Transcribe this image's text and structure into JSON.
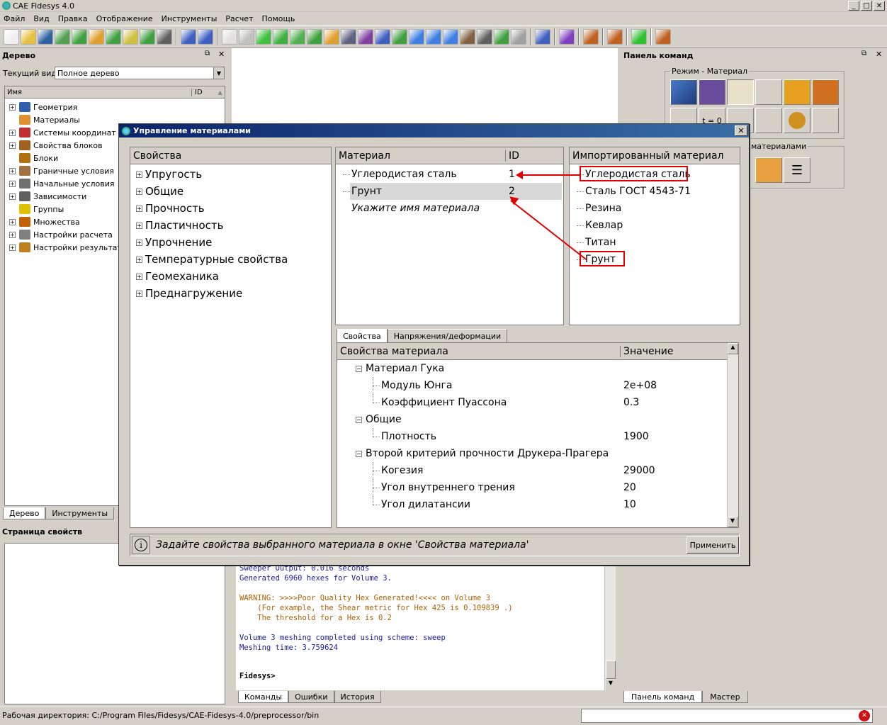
{
  "window": {
    "title": "CAE Fidesys 4.0"
  },
  "menu": [
    "Файл",
    "Вид",
    "Правка",
    "Отображение",
    "Инструменты",
    "Расчет",
    "Помощь"
  ],
  "left": {
    "tree_title": "Дерево",
    "current_view_label": "Текущий вид",
    "current_view_value": "Полное дерево",
    "col_name": "Имя",
    "col_id": "ID",
    "items": [
      {
        "label": "Геометрия",
        "icon": "geometry-icon",
        "color": "#2e5fa8",
        "expand": true
      },
      {
        "label": "Материалы",
        "icon": "materials-icon",
        "color": "#e09030",
        "expand": false
      },
      {
        "label": "Системы координат",
        "icon": "coordinate-icon",
        "color": "#c03030",
        "expand": true
      },
      {
        "label": "Свойства блоков",
        "icon": "block-props-icon",
        "color": "#a06020",
        "expand": true
      },
      {
        "label": "Блоки",
        "icon": "blocks-icon",
        "color": "#b07010",
        "expand": false
      },
      {
        "label": "Граничные условия",
        "icon": "boundary-icon",
        "color": "#a07040",
        "expand": true
      },
      {
        "label": "Начальные условия",
        "icon": "initial-icon",
        "color": "#707070",
        "expand": true
      },
      {
        "label": "Зависимости",
        "icon": "dependency-icon",
        "color": "#606060",
        "expand": true
      },
      {
        "label": "Группы",
        "icon": "groups-icon",
        "color": "#e0c000",
        "expand": false
      },
      {
        "label": "Множества",
        "icon": "sets-icon",
        "color": "#c06000",
        "expand": true
      },
      {
        "label": "Настройки расчета",
        "icon": "calc-settings-icon",
        "color": "#808080",
        "expand": true
      },
      {
        "label": "Настройки результатов",
        "icon": "result-settings-icon",
        "color": "#c08020",
        "expand": true
      }
    ],
    "tabs": [
      "Дерево",
      "Инструменты"
    ],
    "props_title": "Страница свойств"
  },
  "console": {
    "lines": [
      {
        "text": "Sweeper Output: 0.016 seconds",
        "cls": "blue"
      },
      {
        "text": "Generated 6960 hexes for Volume 3.",
        "cls": "blue"
      },
      {
        "text": "",
        "cls": "blue"
      },
      {
        "text": "WARNING: >>>>Poor Quality Hex Generated!<<<< on Volume 3",
        "cls": "orange"
      },
      {
        "text": "    (For example, the Shear metric for Hex 425 is 0.109839 .)",
        "cls": "orange"
      },
      {
        "text": "    The threshold for a Hex is 0.2",
        "cls": "orange"
      },
      {
        "text": "",
        "cls": "blue"
      },
      {
        "text": "Volume 3 meshing completed using scheme: sweep",
        "cls": "blue"
      },
      {
        "text": "Meshing time: 3.759624",
        "cls": "blue"
      }
    ],
    "prompt": "Fidesys>",
    "tabs": [
      "Команды",
      "Ошибки",
      "История"
    ]
  },
  "right": {
    "title": "Панель команд",
    "mode_label": "Режим - Материал",
    "t0_label": "t = 0",
    "group2_label": "материалами",
    "tabs": [
      "Панель команд",
      "Мастер"
    ]
  },
  "statusbar": {
    "text": "Рабочая директория: C:/Program Files/Fidesys/CAE-Fidesys-4.0/preprocessor/bin"
  },
  "dialog": {
    "title": "Управление материалами",
    "props_header": "Свойства",
    "props": [
      "Упругость",
      "Общие",
      "Прочность",
      "Пластичность",
      "Упрочнение",
      "Температурные свойства",
      "Геомеханика",
      "Преднагружение"
    ],
    "mat_header": "Материал",
    "id_header": "ID",
    "materials": [
      {
        "name": "Углеродистая сталь",
        "id": "1"
      },
      {
        "name": "Грунт",
        "id": "2"
      }
    ],
    "mat_placeholder": "Укажите имя материала",
    "imported_header": "Импортированный материал",
    "imported": [
      "Углеродистая сталь",
      "Сталь ГОСТ 4543-71",
      "Резина",
      "Кевлар",
      "Титан",
      "Грунт"
    ],
    "tabs": [
      "Свойства",
      "Напряжения/деформации"
    ],
    "mp_header_name": "Свойства материала",
    "mp_header_value": "Значение",
    "mp_groups": [
      {
        "label": "Материал Гука",
        "rows": [
          {
            "name": "Модуль Юнга",
            "value": "2e+08"
          },
          {
            "name": "Коэффициент Пуассона",
            "value": "0.3"
          }
        ]
      },
      {
        "label": "Общие",
        "rows": [
          {
            "name": "Плотность",
            "value": "1900"
          }
        ]
      },
      {
        "label": "Второй критерий прочности Друкера-Прагера",
        "rows": [
          {
            "name": "Когезия",
            "value": "29000"
          },
          {
            "name": "Угол внутреннего трения",
            "value": "20"
          },
          {
            "name": "Угол дилатансии",
            "value": "10"
          }
        ]
      }
    ],
    "hint": "Задайте свойства выбранного материала в окне 'Свойства материала'",
    "apply": "Применить",
    "accent_red": "#e00000"
  }
}
